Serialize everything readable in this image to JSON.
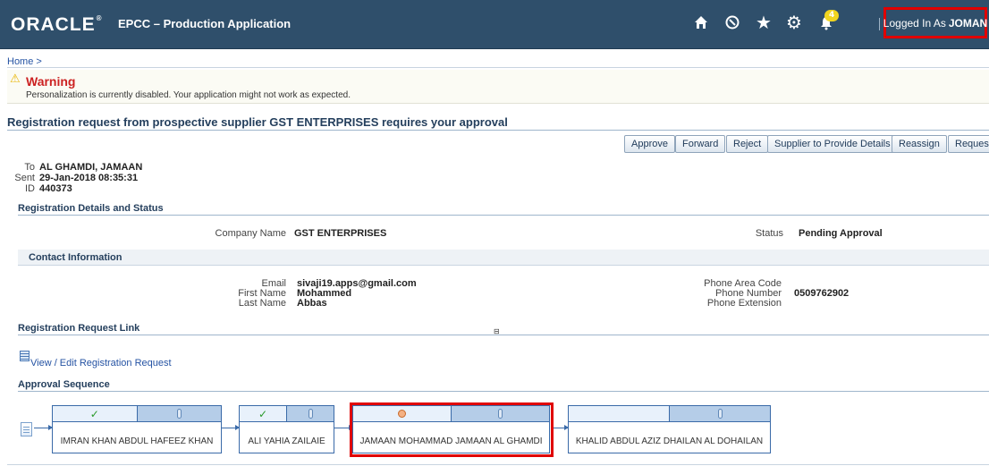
{
  "header": {
    "logo_text": "ORACLE",
    "app_title": "EPCC – Production Application",
    "notification_count": "4",
    "logged_in_prefix": "Logged In As",
    "logged_in_user": "JOMAN",
    "icons": [
      "home-icon",
      "navigator-icon",
      "favorites-star-icon",
      "settings-gear-icon",
      "notifications-bell-icon"
    ]
  },
  "breadcrumb": "Home >",
  "warning": {
    "title": "Warning",
    "message": "Personalization is currently disabled. Your application might not work as expected."
  },
  "page_title": "Registration request from prospective supplier GST ENTERPRISES requires your approval",
  "actions": [
    "Approve",
    "Forward",
    "Reject",
    "Supplier to Provide Details",
    "Reassign",
    "Request"
  ],
  "notification": {
    "to_label": "To",
    "to": "AL GHAMDI, JAMAAN",
    "sent_label": "Sent",
    "sent": "29-Jan-2018 08:35:31",
    "id_label": "ID",
    "id": "440373"
  },
  "registration": {
    "section_title": "Registration Details and Status",
    "company_label": "Company Name",
    "company": "GST ENTERPRISES",
    "status_label": "Status",
    "status": "Pending Approval"
  },
  "contact": {
    "section_title": "Contact Information",
    "email_label": "Email",
    "email": "sivaji19.apps@gmail.com",
    "first_name_label": "First Name",
    "first_name": "Mohammed",
    "last_name_label": "Last Name",
    "last_name": "Abbas",
    "phone_area_label": "Phone Area Code",
    "phone_area": "",
    "phone_number_label": "Phone Number",
    "phone_number": "0509762902",
    "phone_ext_label": "Phone Extension",
    "phone_ext": ""
  },
  "request_link": {
    "section_title": "Registration Request Link",
    "link_text": "View / Edit Registration Request"
  },
  "approval": {
    "section_title": "Approval Sequence",
    "approvers": [
      {
        "name": "IMRAN KHAN ABDUL HAFEEZ KHAN",
        "state": "approved"
      },
      {
        "name": "ALI YAHIA ZAILAIE",
        "state": "approved"
      },
      {
        "name": "JAMAAN MOHAMMAD JAMAAN AL GHAMDI",
        "state": "pending"
      },
      {
        "name": "KHALID ABDUL AZIZ DHAILAN AL DOHAILAN",
        "state": "future"
      }
    ],
    "approved_mark": "✓"
  },
  "colors": {
    "header_bg": "#2f4f6b",
    "highlight_red": "#e00000",
    "warning_red": "#cc2222",
    "link_blue": "#2553a3"
  }
}
